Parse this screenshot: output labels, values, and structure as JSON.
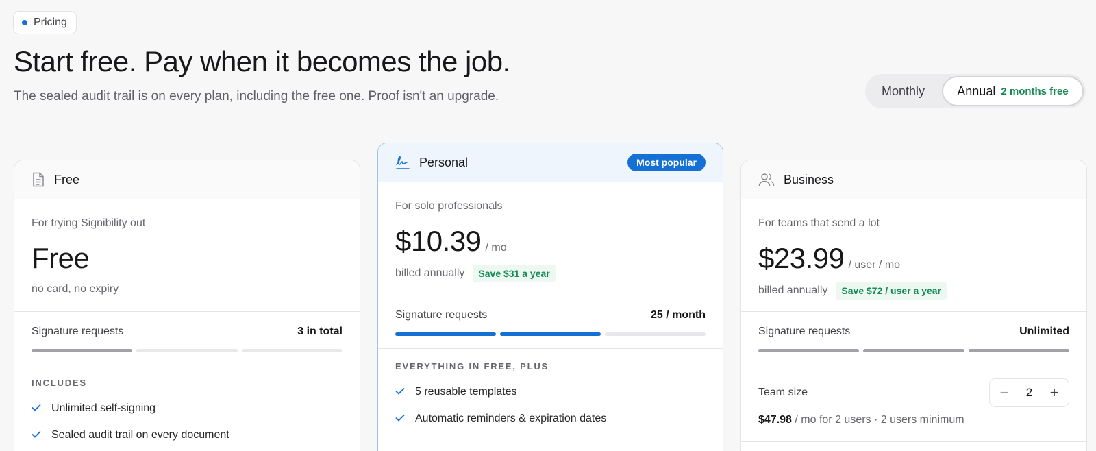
{
  "eyebrow": {
    "label": "Pricing"
  },
  "hero": {
    "headline": "Start free. Pay when it becomes the job.",
    "subhead": "The sealed audit trail is on every plan, including the free one. Proof isn't an upgrade."
  },
  "billing": {
    "monthly_label": "Monthly",
    "annual_label": "Annual",
    "annual_badge": "2 months free",
    "selected": "Annual"
  },
  "plans": {
    "free": {
      "icon": "document-icon",
      "name": "Free",
      "tagline": "For trying Signibility out",
      "price": "Free",
      "note": "no card, no expiry",
      "quota_label": "Signature requests",
      "quota_value": "3 in total",
      "quota_level": 1,
      "includes_title": "INCLUDES",
      "features": [
        "Unlimited self-signing",
        "Sealed audit trail on every document"
      ]
    },
    "personal": {
      "icon": "signature-icon",
      "name": "Personal",
      "badge": "Most popular",
      "tagline": "For solo professionals",
      "price": "$10.39",
      "price_unit": "/ mo",
      "billing_note": "billed annually",
      "save": "Save $31 a year",
      "quota_label": "Signature requests",
      "quota_value": "25 / month",
      "quota_level": 2,
      "includes_title": "EVERYTHING IN FREE, PLUS",
      "features": [
        "5 reusable templates",
        "Automatic reminders & expiration dates"
      ]
    },
    "business": {
      "icon": "users-icon",
      "name": "Business",
      "tagline": "For teams that send a lot",
      "price": "$23.99",
      "price_unit": "/ user / mo",
      "billing_note": "billed annually",
      "save": "Save $72 / user a year",
      "quota_label": "Signature requests",
      "quota_value": "Unlimited",
      "quota_level": 3,
      "team_label": "Team size",
      "team_size": "2",
      "team_cost": "$47.98",
      "team_cost_suffix": "/ mo for 2 users · 2 users minimum"
    }
  },
  "colors": {
    "accent": "#1570d6",
    "save_green": "#168a55"
  }
}
